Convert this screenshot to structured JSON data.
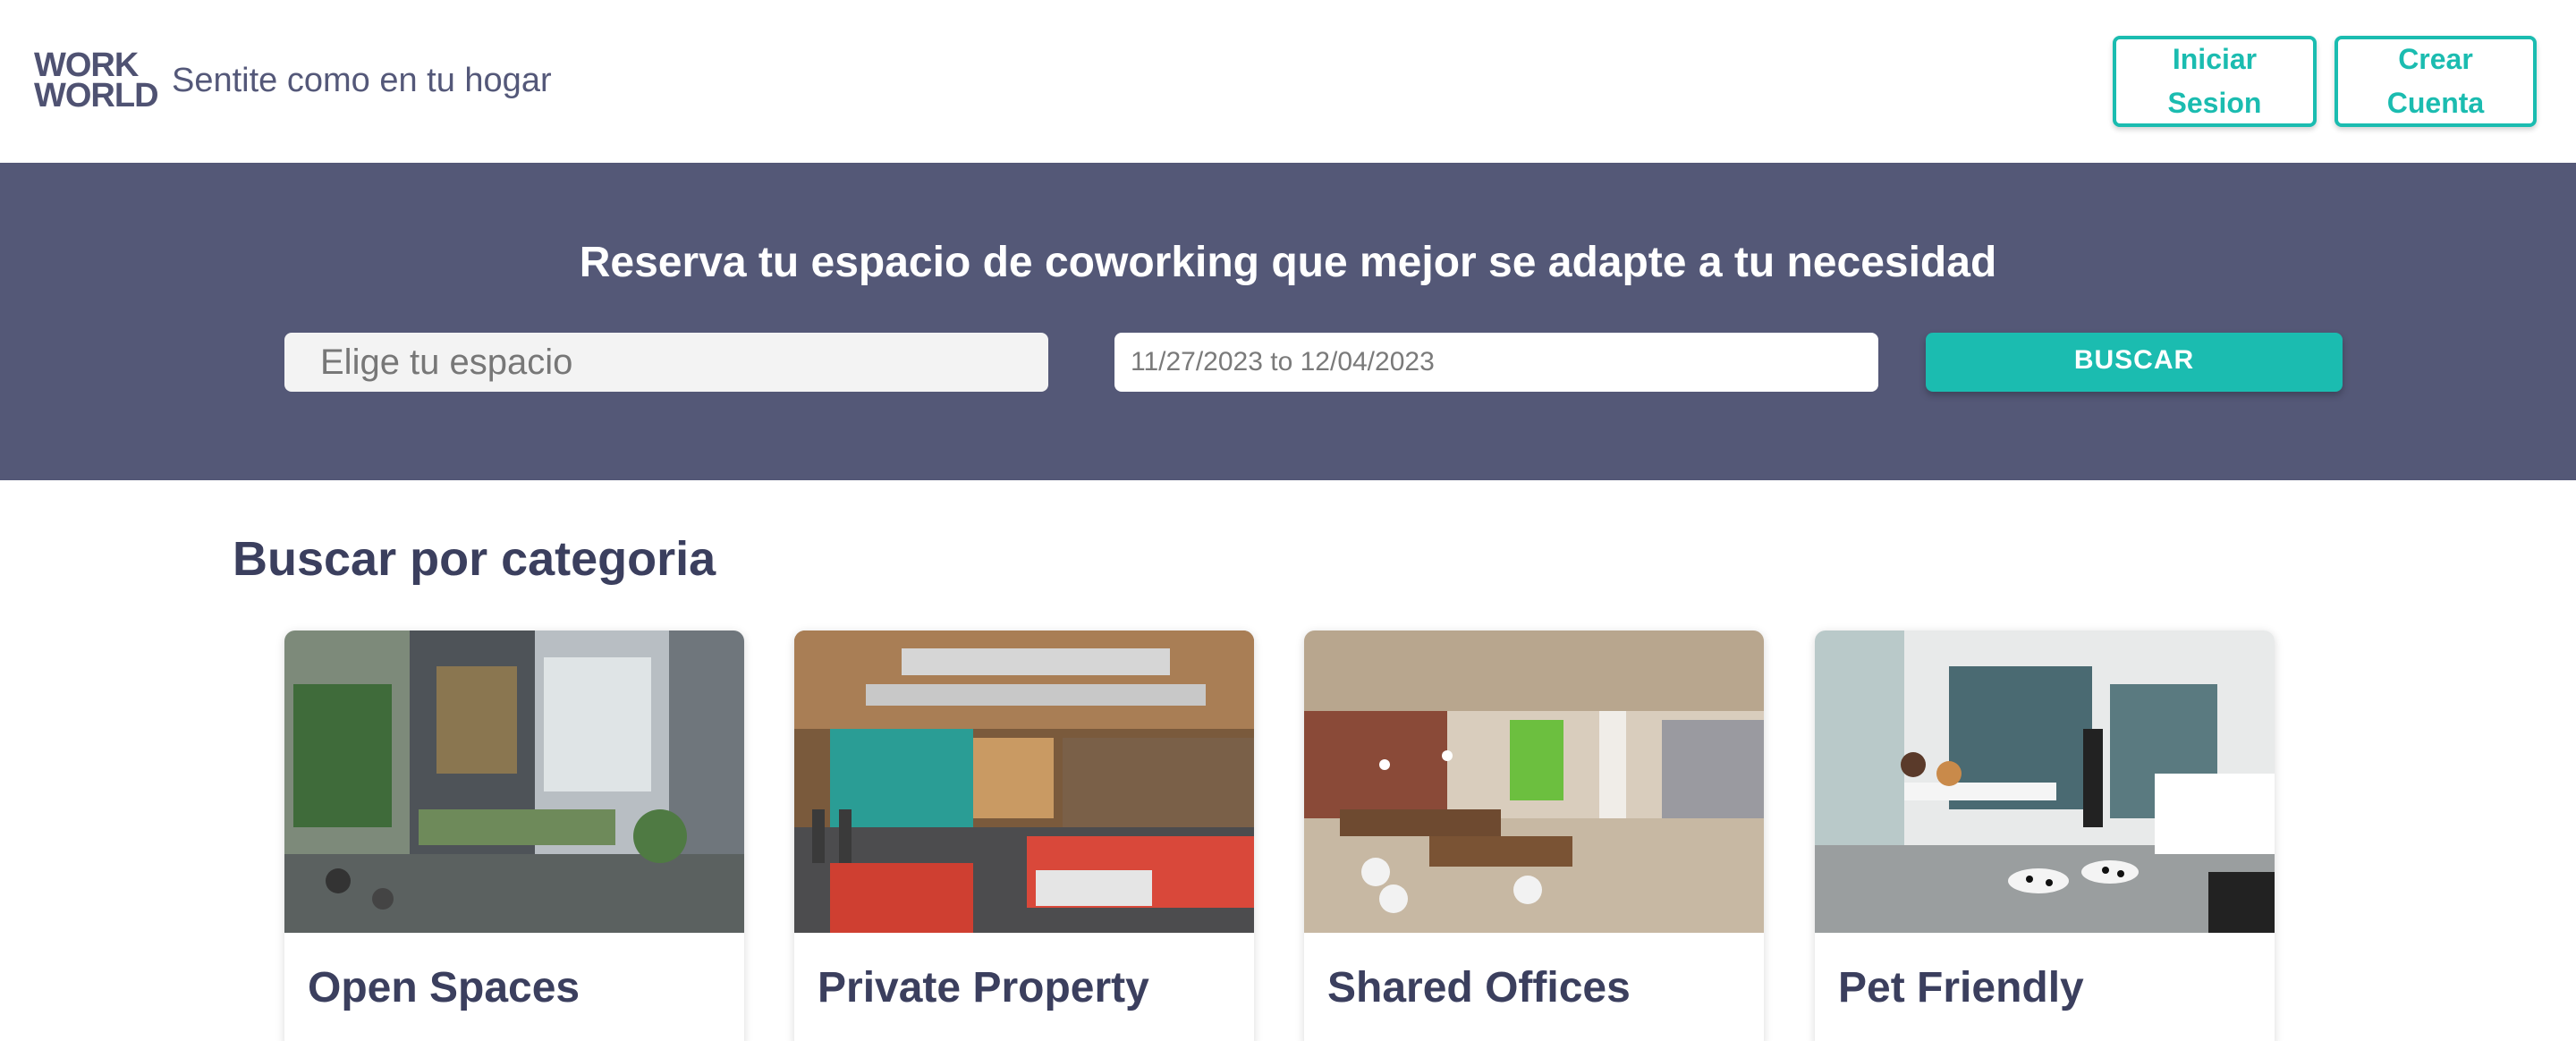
{
  "header": {
    "logo_line1": "WORK",
    "logo_line2": "WORLD",
    "tagline": "Sentite como en tu hogar",
    "login_line1": "Iniciar",
    "login_line2": "Sesion",
    "signup_line1": "Crear",
    "signup_line2": "Cuenta"
  },
  "hero": {
    "title": "Reserva tu espacio de coworking que mejor se adapte a tu necesidad",
    "space_placeholder": "Elige tu espacio",
    "date_range": "11/27/2023 to 12/04/2023",
    "search_label": "BUSCAR"
  },
  "categories": {
    "title": "Buscar por categoria",
    "items": [
      {
        "name": "Open Spaces"
      },
      {
        "name": "Private Property"
      },
      {
        "name": "Shared Offices"
      },
      {
        "name": "Pet Friendly"
      }
    ]
  },
  "colors": {
    "accent": "#1bbcb0",
    "hero_bg": "#545877",
    "heading": "#3b3f5e"
  }
}
